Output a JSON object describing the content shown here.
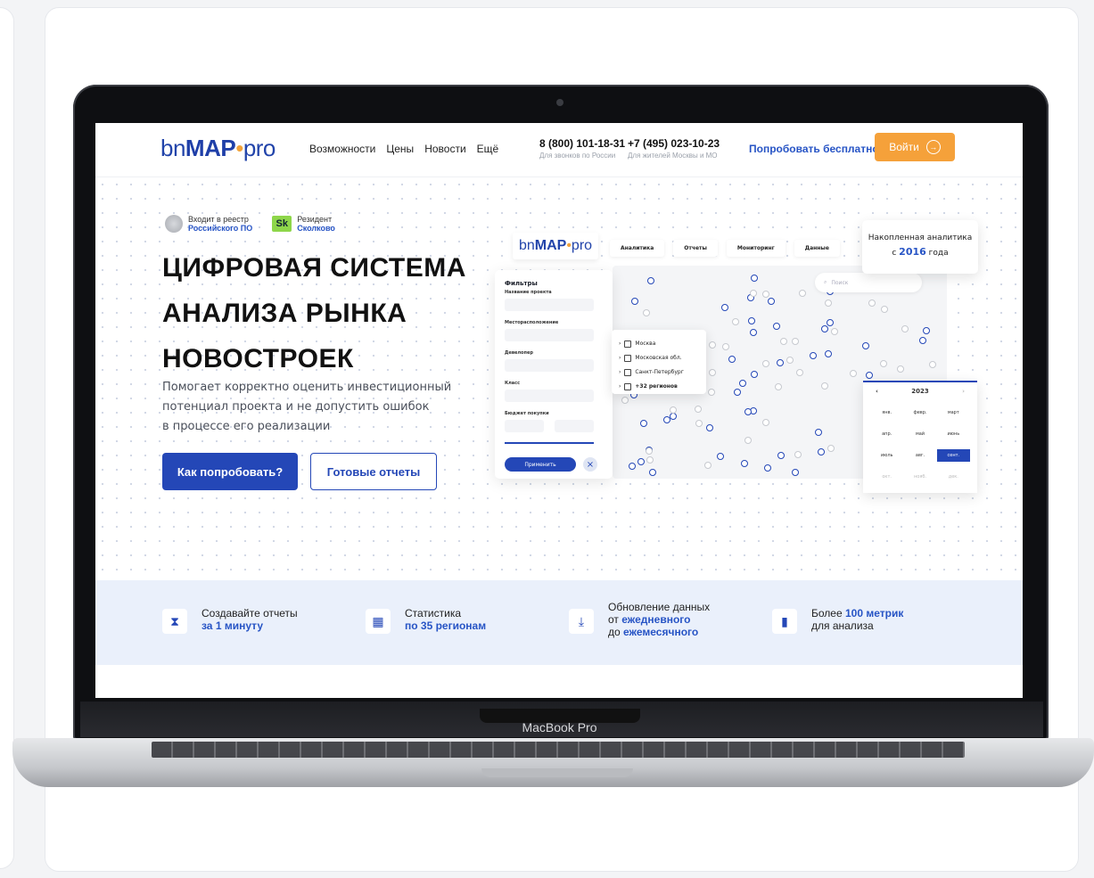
{
  "navbar": {
    "logo_prefix": "bn",
    "logo_main": "MAP",
    "logo_suffix": "pro",
    "links": [
      "Возможности",
      "Цены",
      "Новости",
      "Ещё"
    ],
    "phone1": {
      "number": "8 (800) 101-18-31",
      "note": "Для звонков по России"
    },
    "phone2": {
      "number": "+7 (495) 023-10-23",
      "note": "Для жителей Москвы и МО"
    },
    "try_free": "Попробовать бесплатно",
    "login": "Войти"
  },
  "hero": {
    "badge1_line1": "Входит в реестр",
    "badge1_line2": "Российского ПО",
    "badge2_logo": "Sk",
    "badge2_line1": "Резидент",
    "badge2_line2": "Сколково",
    "title_lines": [
      "ЦИФРОВАЯ СИСТЕМА",
      "АНАЛИЗА РЫНКА",
      "НОВОСТРОЕК"
    ],
    "subtitle_lines": [
      "Помогает корректно оценить инвестиционный",
      "потенциал проекта и не допустить ошибок",
      "в процессе его реализации"
    ],
    "primary_button": "Как попробовать?",
    "secondary_button": "Готовые отчеты"
  },
  "mockup": {
    "tabs": [
      "Аналитика",
      "Отчеты",
      "Мониторинг",
      "Данные"
    ],
    "callout_line1": "Накопленная аналитика",
    "callout_prefix": "с",
    "callout_year": "2016",
    "callout_suffix": "года",
    "search_placeholder": "Поиск",
    "filters": {
      "title": "Фильтры",
      "labels": [
        "Название проекта",
        "Месторасположение",
        "Девелопер",
        "Класс",
        "Бюджет покупки"
      ],
      "apply": "Применить"
    },
    "regions": [
      "Москва",
      "Московская обл.",
      "Санкт-Петербург",
      "+32 регионов"
    ],
    "calendar": {
      "year": "2023",
      "months": [
        "янв.",
        "февр.",
        "март",
        "апр.",
        "май",
        "июнь",
        "июль",
        "авг.",
        "сент.",
        "окт.",
        "нояб.",
        "дек."
      ],
      "selected": "сент."
    }
  },
  "features": [
    {
      "line1": "Создавайте отчеты",
      "line2": "за 1 минуту",
      "icon": "hourglass-icon"
    },
    {
      "line1": "Статистика",
      "line2": "по 35 регионам",
      "icon": "map-icon"
    },
    {
      "line1": "Обновление данных",
      "line2_prefix": "от",
      "line2": "ежедневного",
      "line3_prefix": "до",
      "line3": "ежемесячного",
      "icon": "download-icon"
    },
    {
      "line1_prefix": "Более",
      "line1_hl": "100 метрик",
      "line2": "для анализа",
      "icon": "bar-chart-icon"
    }
  ],
  "device_label": "MacBook Pro",
  "colors": {
    "brand_blue": "#2447b7",
    "accent_orange": "#f5a13a",
    "feature_bg": "#eaf0fb"
  }
}
